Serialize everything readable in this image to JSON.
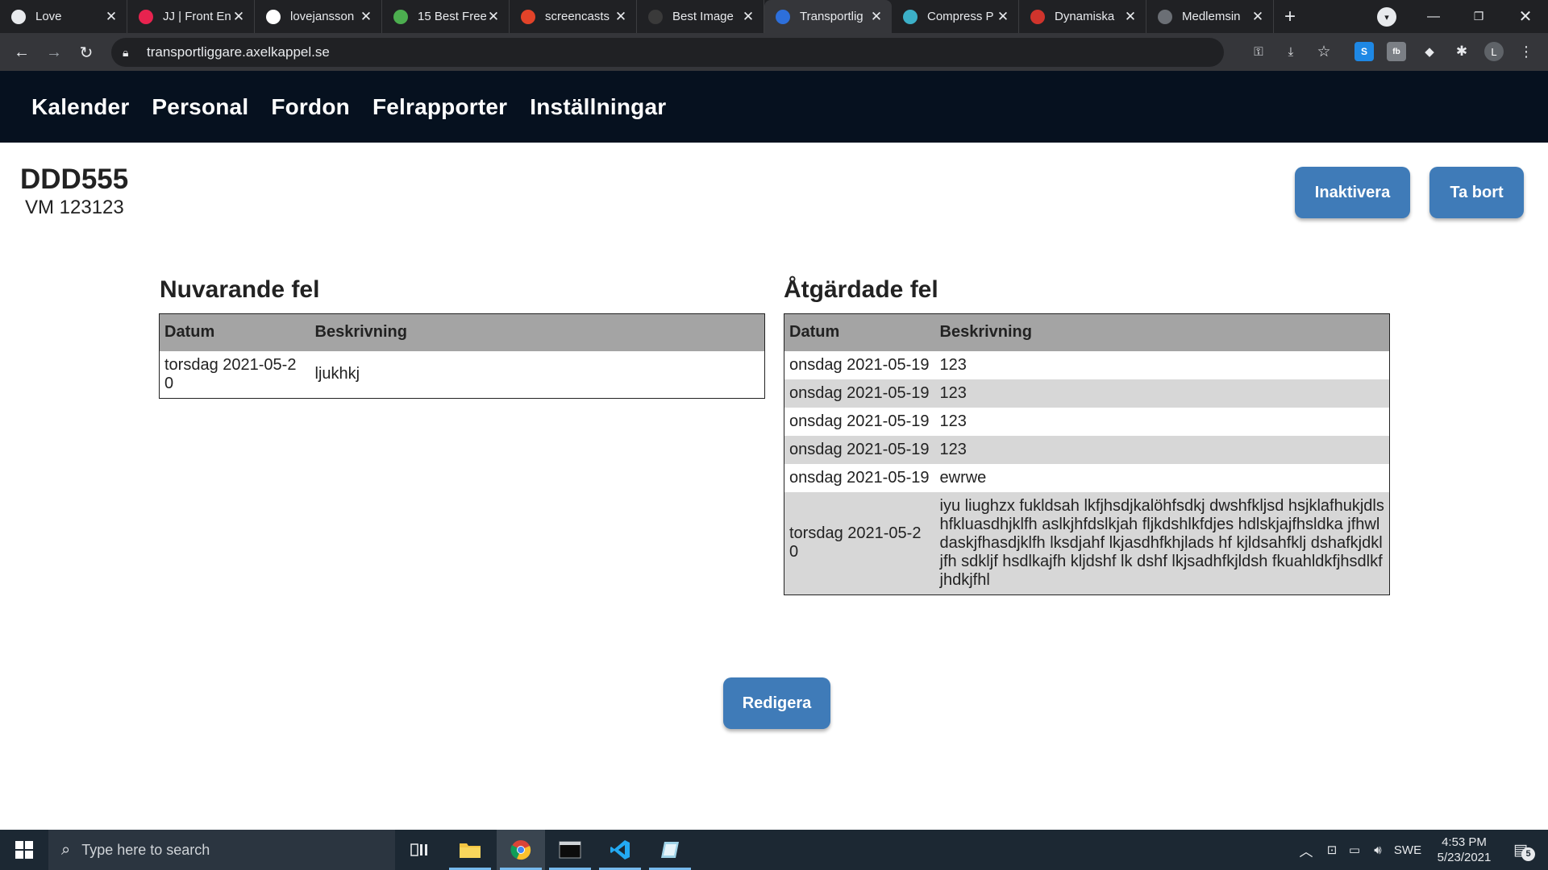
{
  "browser": {
    "tabs": [
      {
        "title": "Love",
        "favicon": "love-favicon",
        "color": "#e8eaed",
        "active": false
      },
      {
        "title": "JJ | Front En",
        "favicon": "jj-favicon",
        "color": "#e8234f",
        "active": false
      },
      {
        "title": "lovejansson",
        "favicon": "github-favicon",
        "color": "#ffffff",
        "active": false
      },
      {
        "title": "15 Best Free",
        "favicon": "leaf-favicon",
        "color": "#4cae4f",
        "active": false
      },
      {
        "title": "screencasts",
        "favicon": "gitlab-favicon",
        "color": "#e24329",
        "active": false
      },
      {
        "title": "Best Image",
        "favicon": "dark-circle-favicon",
        "color": "#3a3a3a",
        "active": false
      },
      {
        "title": "Transportlig",
        "favicon": "t-favicon",
        "color": "#2d6fdb",
        "active": true
      },
      {
        "title": "Compress P",
        "favicon": "compress-favicon",
        "color": "#3cb0c8",
        "active": false
      },
      {
        "title": "Dynamiska",
        "favicon": "dynamiska-favicon",
        "color": "#d0342c",
        "active": false
      },
      {
        "title": "Medlemsin",
        "favicon": "globe-favicon",
        "color": "#6b6f75",
        "active": false
      }
    ],
    "url": "transportliggare.axelkappel.se",
    "profile_initial": "L"
  },
  "nav": {
    "items": [
      "Kalender",
      "Personal",
      "Fordon",
      "Felrapporter",
      "Inställningar"
    ]
  },
  "vehicle": {
    "plate": "DDD555",
    "subtitle": "VM 123123"
  },
  "actions": {
    "deactivate": "Inaktivera",
    "delete": "Ta bort",
    "edit": "Redigera"
  },
  "current_faults": {
    "heading": "Nuvarande fel",
    "columns": [
      "Datum",
      "Beskrivning"
    ],
    "rows": [
      {
        "date": "torsdag 2021-05-20",
        "description": "ljukhkj"
      }
    ]
  },
  "fixed_faults": {
    "heading": "Åtgärdade fel",
    "columns": [
      "Datum",
      "Beskrivning"
    ],
    "rows": [
      {
        "date": "onsdag 2021-05-19",
        "description": "123"
      },
      {
        "date": "onsdag 2021-05-19",
        "description": "123"
      },
      {
        "date": "onsdag 2021-05-19",
        "description": "123"
      },
      {
        "date": "onsdag 2021-05-19",
        "description": "123"
      },
      {
        "date": "onsdag 2021-05-19",
        "description": "ewrwe"
      },
      {
        "date": "torsdag 2021-05-20",
        "description": "iyu liughzx fukldsah lkfjhsdjkalöhfsdkj dwshfkljsd hsjklafhukjdls hfkluasdhjklfh aslkjhfdslkjah fljkdshlkfdjes hdlskjajfhsldka jfhwldaskjfhasdjklfh lksdjahf lkjasdhfkhjlads hf kjldsahfklj dshafkjdkljfh sdkljf hsdlkajfh kljdshf lk dshf lkjsadhfkjldsh fkuahldkfjhsdlkfjhdkjfhl"
      }
    ]
  },
  "taskbar": {
    "search_placeholder": "Type here to search",
    "language": "SWE",
    "time": "4:53 PM",
    "date": "5/23/2021",
    "notification_count": "5"
  }
}
